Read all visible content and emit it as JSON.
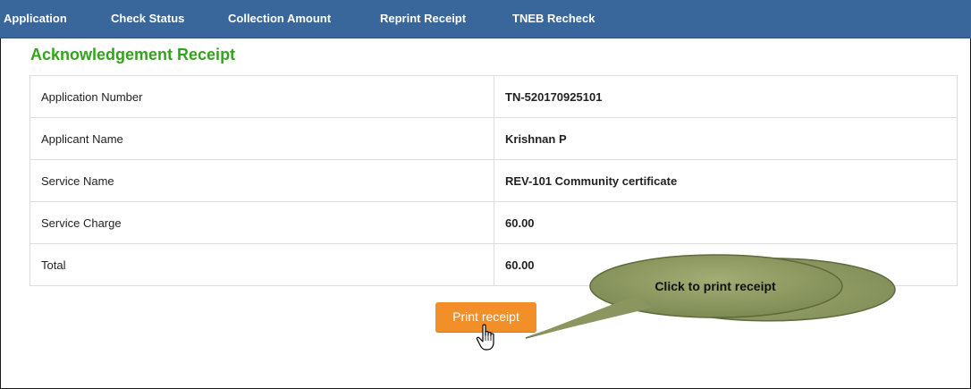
{
  "nav": {
    "items": [
      "Application",
      "Check Status",
      "Collection Amount",
      "Reprint Receipt",
      "TNEB Recheck"
    ]
  },
  "page": {
    "title": "Acknowledgement Receipt"
  },
  "receipt": {
    "rows": [
      {
        "label": "Application Number",
        "value": "TN-520170925101"
      },
      {
        "label": "Applicant Name",
        "value": "Krishnan P"
      },
      {
        "label": "Service Name",
        "value": "REV-101 Community certificate"
      },
      {
        "label": "Service Charge",
        "value": "60.00"
      },
      {
        "label": "Total",
        "value": "60.00"
      }
    ]
  },
  "actions": {
    "print_label": "Print receipt"
  },
  "callout": {
    "text": "Click to print receipt"
  },
  "icons": {
    "cursor": "hand-pointer-icon"
  },
  "colors": {
    "navbar": "#3a679b",
    "title": "#33a31c",
    "button": "#f28f28",
    "callout": "#8e9a63"
  }
}
